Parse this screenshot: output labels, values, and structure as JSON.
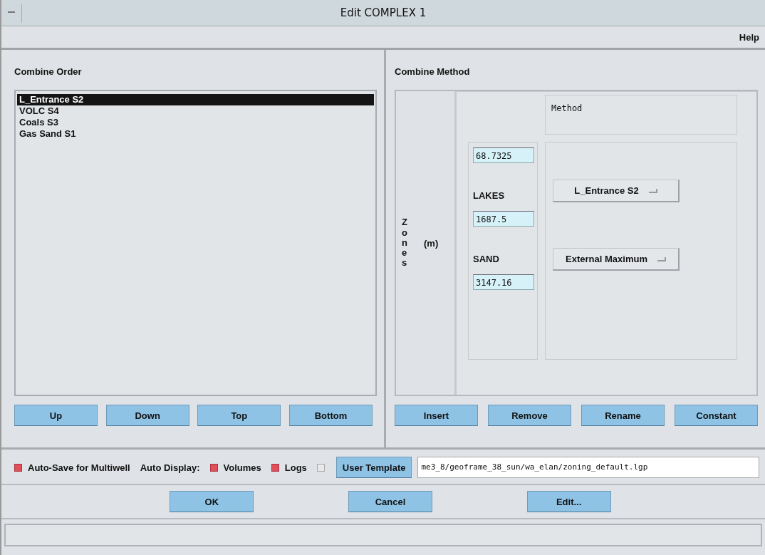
{
  "window": {
    "title": "Edit COMPLEX 1"
  },
  "menu": [
    "Help"
  ],
  "combine_order": {
    "title": "Combine Order",
    "items": [
      {
        "label": "L_Entrance S2",
        "selected": true
      },
      {
        "label": "VOLC S4",
        "selected": false
      },
      {
        "label": "Coals S3",
        "selected": false
      },
      {
        "label": "Gas Sand S1",
        "selected": false
      }
    ],
    "buttons": [
      "Up",
      "Down",
      "Top",
      "Bottom"
    ]
  },
  "combine_method": {
    "title": "Combine Method",
    "zones_label": "Zones",
    "unit": "(m)",
    "method_header": "Method",
    "depths": [
      "68.7325",
      "1687.5",
      "3147.16"
    ],
    "zones": [
      {
        "name": "LAKES",
        "method": "L_Entrance S2"
      },
      {
        "name": "SAND",
        "method": "External Maximum"
      }
    ],
    "buttons": [
      "Insert",
      "Remove",
      "Rename",
      "Constant"
    ]
  },
  "options": [
    {
      "kind": "checkbox",
      "label": "Auto-Save for Multiwell",
      "checked": true
    },
    {
      "kind": "label",
      "label": "Auto Display:"
    },
    {
      "kind": "checkbox",
      "label": "Volumes",
      "checked": true
    },
    {
      "kind": "checkbox",
      "label": "Logs",
      "checked": true
    },
    {
      "kind": "checkbox",
      "checked": false
    },
    {
      "kind": "button",
      "label": "User Template"
    },
    {
      "kind": "path",
      "value": "me3_8/geoframe_38_sun/wa_elan/zoning_default.lgp"
    }
  ],
  "dialog_buttons": [
    "OK",
    "Cancel",
    "Edit..."
  ]
}
